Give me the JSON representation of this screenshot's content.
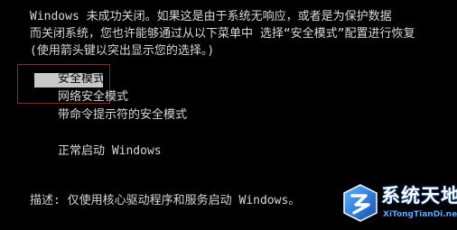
{
  "message": {
    "line1": "Windows 未成功关闭。如果这是由于系统无响应，或者是为保护数据",
    "line2": "而关闭系统，您也许能够通过从以下菜单中 选择“安全模式”配置进行恢复",
    "line3": "(使用箭头键以突出显示您的选择。)"
  },
  "menu": {
    "items": [
      {
        "label": "安全模式",
        "selected": true
      },
      {
        "label": "网络安全模式",
        "selected": false
      },
      {
        "label": "带命令提示符的安全模式",
        "selected": false
      },
      {
        "label": "正常启动 Windows",
        "selected": false
      }
    ]
  },
  "description": "描述: 仅使用核心驱动程序和服务启动 Windows。",
  "watermark": {
    "title": "系统天地",
    "url": "XiTongTianDi.net"
  },
  "colors": {
    "background": "#000000",
    "text": "#d8d8d8",
    "highlight": "#c8c8c8",
    "annotation_box": "#a32020",
    "watermark_blue": "#1e6fd9"
  }
}
